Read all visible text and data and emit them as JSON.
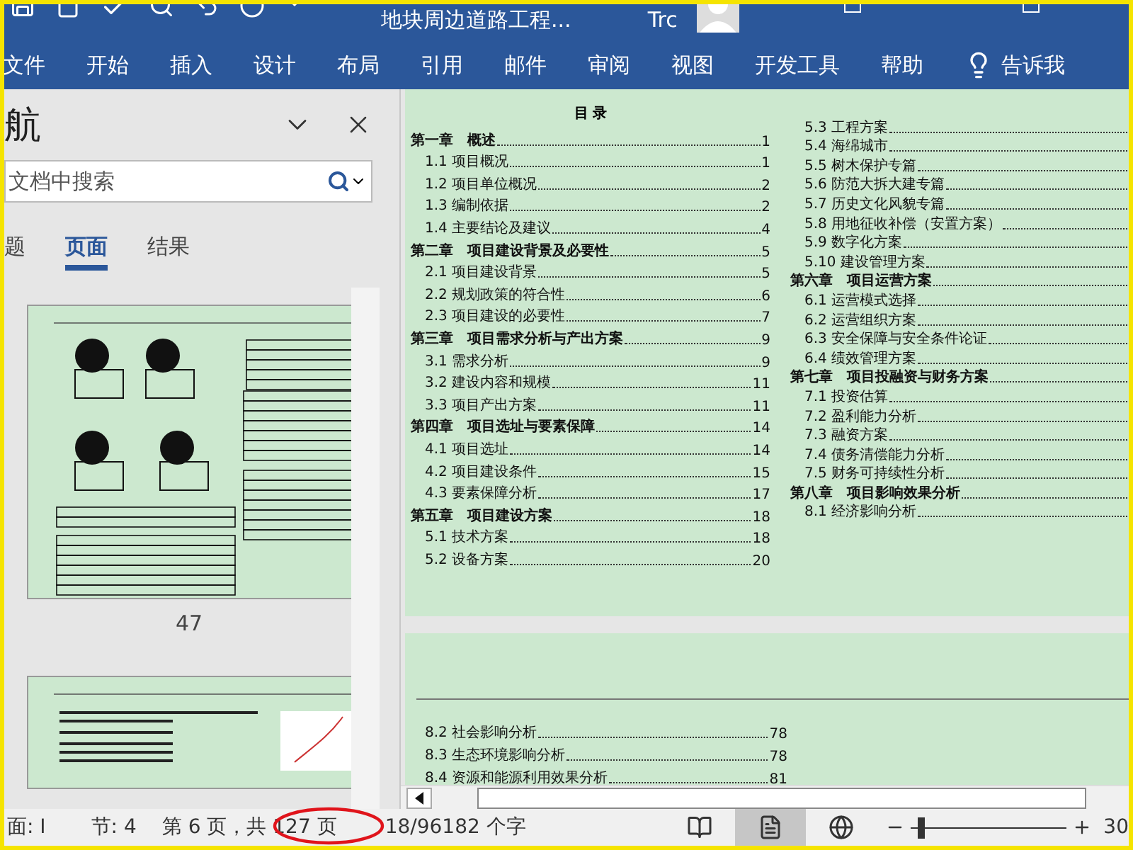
{
  "title_bar": {
    "document_title": "地块周边道路工程...",
    "user": "Trc"
  },
  "ribbon_tabs": [
    "文件",
    "开始",
    "插入",
    "设计",
    "布局",
    "引用",
    "邮件",
    "审阅",
    "视图",
    "开发工具",
    "帮助"
  ],
  "tell_me": "告诉我",
  "navigation_pane": {
    "title": "航",
    "search": {
      "placeholder": "文档中搜索"
    },
    "tabs": [
      {
        "label": "题",
        "selected": false
      },
      {
        "label": "页面",
        "selected": true
      },
      {
        "label": "结果",
        "selected": false
      }
    ],
    "thumbnail_label": "47"
  },
  "document": {
    "toc_title": "目 录",
    "toc_left": [
      {
        "kind": "chapter",
        "text": "第一章　概述",
        "page": "1"
      },
      {
        "kind": "section",
        "text": "1.1 项目概况",
        "page": "1"
      },
      {
        "kind": "section",
        "text": "1.2 项目单位概况",
        "page": "2"
      },
      {
        "kind": "section",
        "text": "1.3 编制依据",
        "page": "2"
      },
      {
        "kind": "section",
        "text": "1.4 主要结论及建议",
        "page": "4"
      },
      {
        "kind": "chapter",
        "text": "第二章　项目建设背景及必要性",
        "page": "5"
      },
      {
        "kind": "section",
        "text": "2.1 项目建设背景",
        "page": "5"
      },
      {
        "kind": "section",
        "text": "2.2 规划政策的符合性",
        "page": "6"
      },
      {
        "kind": "section",
        "text": "2.3 项目建设的必要性",
        "page": "7"
      },
      {
        "kind": "chapter",
        "text": "第三章　项目需求分析与产出方案",
        "page": "9"
      },
      {
        "kind": "section",
        "text": "3.1 需求分析",
        "page": "9"
      },
      {
        "kind": "section",
        "text": "3.2 建设内容和规模",
        "page": "11"
      },
      {
        "kind": "section",
        "text": "3.3 项目产出方案",
        "page": "11"
      },
      {
        "kind": "chapter",
        "text": "第四章　项目选址与要素保障",
        "page": "14"
      },
      {
        "kind": "section",
        "text": "4.1 项目选址",
        "page": "14"
      },
      {
        "kind": "section",
        "text": "4.2 项目建设条件",
        "page": "15"
      },
      {
        "kind": "section",
        "text": "4.3 要素保障分析",
        "page": "17"
      },
      {
        "kind": "chapter",
        "text": "第五章　项目建设方案",
        "page": "18"
      },
      {
        "kind": "section",
        "text": "5.1 技术方案",
        "page": "18"
      },
      {
        "kind": "section",
        "text": "5.2 设备方案",
        "page": "20"
      }
    ],
    "toc_right": [
      {
        "kind": "section",
        "text": "5.3 工程方案"
      },
      {
        "kind": "section",
        "text": "5.4 海绵城市"
      },
      {
        "kind": "section",
        "text": "5.5 树木保护专篇"
      },
      {
        "kind": "section",
        "text": "5.6 防范大拆大建专篇"
      },
      {
        "kind": "section",
        "text": "5.7 历史文化风貌专篇"
      },
      {
        "kind": "section",
        "text": "5.8 用地征收补偿（安置方案）"
      },
      {
        "kind": "section",
        "text": "5.9 数字化方案"
      },
      {
        "kind": "section",
        "text": "5.10 建设管理方案"
      },
      {
        "kind": "chapter",
        "text": "第六章　项目运营方案"
      },
      {
        "kind": "section",
        "text": "6.1 运营模式选择"
      },
      {
        "kind": "section",
        "text": "6.2 运营组织方案"
      },
      {
        "kind": "section",
        "text": "6.3 安全保障与安全条件论证"
      },
      {
        "kind": "section",
        "text": "6.4 绩效管理方案"
      },
      {
        "kind": "chapter",
        "text": "第七章　项目投融资与财务方案"
      },
      {
        "kind": "section",
        "text": "7.1 投资估算"
      },
      {
        "kind": "section",
        "text": "7.2 盈利能力分析"
      },
      {
        "kind": "section",
        "text": "7.3 融资方案"
      },
      {
        "kind": "section",
        "text": "7.4 债务清偿能力分析"
      },
      {
        "kind": "section",
        "text": "7.5 财务可持续性分析"
      },
      {
        "kind": "chapter",
        "text": "第八章　项目影响效果分析"
      },
      {
        "kind": "section",
        "text": "8.1 经济影响分析"
      }
    ],
    "next_page": [
      {
        "text": "8.2 社会影响分析",
        "page": "78"
      },
      {
        "text": "8.3 生态环境影响分析",
        "page": "78"
      },
      {
        "text": "8.4 资源和能源利用效果分析",
        "page": "81"
      }
    ]
  },
  "status_bar": {
    "page": "面: I",
    "section": "节: 4",
    "page_count": "第 6 页，共 127 页",
    "word_count": "18/96182 个字",
    "views": [
      {
        "kind": "read",
        "selected": false
      },
      {
        "kind": "print",
        "selected": true
      },
      {
        "kind": "web",
        "selected": false
      }
    ],
    "zoom": {
      "level": 0.04,
      "percent": "30"
    }
  }
}
